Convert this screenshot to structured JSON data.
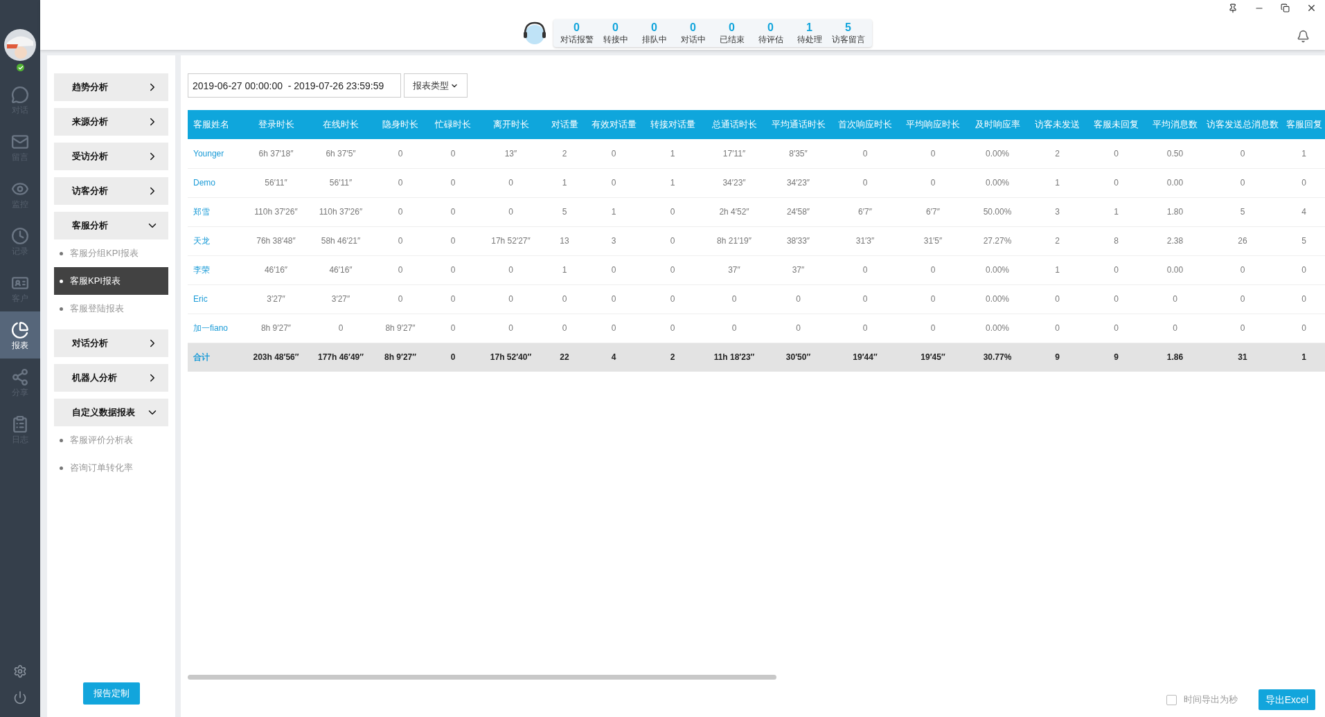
{
  "nav": [
    {
      "label": "对话",
      "selected": false
    },
    {
      "label": "留言",
      "selected": false
    },
    {
      "label": "监控",
      "selected": false
    },
    {
      "label": "记录",
      "selected": false
    },
    {
      "label": "客户",
      "selected": false
    },
    {
      "label": "报表",
      "selected": true
    },
    {
      "label": "分享",
      "selected": false
    },
    {
      "label": "日志",
      "selected": false
    }
  ],
  "stats": [
    {
      "value": "0",
      "label": "对话报警"
    },
    {
      "value": "0",
      "label": "转接中"
    },
    {
      "value": "0",
      "label": "排队中"
    },
    {
      "value": "0",
      "label": "对话中"
    },
    {
      "value": "0",
      "label": "已结束"
    },
    {
      "value": "0",
      "label": "待评估"
    },
    {
      "value": "1",
      "label": "待处理"
    },
    {
      "value": "5",
      "label": "访客留言"
    }
  ],
  "menu": [
    {
      "label": "趋势分析",
      "expanded": false
    },
    {
      "label": "来源分析",
      "expanded": false
    },
    {
      "label": "受访分析",
      "expanded": false
    },
    {
      "label": "访客分析",
      "expanded": false
    },
    {
      "label": "客服分析",
      "expanded": true,
      "children": [
        {
          "label": "客服分组KPI报表",
          "selected": false
        },
        {
          "label": "客服KPI报表",
          "selected": true
        },
        {
          "label": "客服登陆报表",
          "selected": false
        }
      ]
    },
    {
      "label": "对话分析",
      "expanded": false
    },
    {
      "label": "机器人分析",
      "expanded": false
    },
    {
      "label": "自定义数据报表",
      "expanded": true,
      "children": [
        {
          "label": "客服评价分析表",
          "selected": false
        },
        {
          "label": "咨询订单转化率",
          "selected": false
        }
      ]
    }
  ],
  "customize_button": "报告定制",
  "date_range": "2019-06-27 00:00:00  - 2019-07-26 23:59:59",
  "report_type_button": "报表类型",
  "table": {
    "columns": [
      "客服姓名",
      "登录时长",
      "在线时长",
      "隐身时长",
      "忙碌时长",
      "离开时长",
      "对话量",
      "有效对话量",
      "转接对话量",
      "总通话时长",
      "平均通话时长",
      "首次响应时长",
      "平均响应时长",
      "及时响应率",
      "访客未发送",
      "客服未回复",
      "平均消息数",
      "访客发送总消息数",
      "客服回复"
    ],
    "rows": [
      {
        "cells": [
          "Younger",
          "6h 37′18″",
          "6h 37′5″",
          "0",
          "0",
          "13″",
          "2",
          "0",
          "1",
          "17′11″",
          "8′35″",
          "0",
          "0",
          "0.00%",
          "2",
          "0",
          "0.50",
          "0",
          "1"
        ]
      },
      {
        "cells": [
          "Demo",
          "56′11″",
          "56′11″",
          "0",
          "0",
          "0",
          "1",
          "0",
          "1",
          "34′23″",
          "34′23″",
          "0",
          "0",
          "0.00%",
          "1",
          "0",
          "0.00",
          "0",
          "0"
        ]
      },
      {
        "cells": [
          "郑雪",
          "110h 37′26″",
          "110h 37′26″",
          "0",
          "0",
          "0",
          "5",
          "1",
          "0",
          "2h 4′52″",
          "24′58″",
          "6′7″",
          "6′7″",
          "50.00%",
          "3",
          "1",
          "1.80",
          "5",
          "4"
        ]
      },
      {
        "cells": [
          "天龙",
          "76h 38′48″",
          "58h 46′21″",
          "0",
          "0",
          "17h 52′27″",
          "13",
          "3",
          "0",
          "8h 21′19″",
          "38′33″",
          "31′3″",
          "31′5″",
          "27.27%",
          "2",
          "8",
          "2.38",
          "26",
          "5"
        ]
      },
      {
        "cells": [
          "李荣",
          "46′16″",
          "46′16″",
          "0",
          "0",
          "0",
          "1",
          "0",
          "0",
          "37″",
          "37″",
          "0",
          "0",
          "0.00%",
          "1",
          "0",
          "0.00",
          "0",
          "0"
        ]
      },
      {
        "cells": [
          "Eric",
          "3′27″",
          "3′27″",
          "0",
          "0",
          "0",
          "0",
          "0",
          "0",
          "0",
          "0",
          "0",
          "0",
          "0.00%",
          "0",
          "0",
          "0",
          "0",
          "0"
        ]
      },
      {
        "cells": [
          "加一fiano",
          "8h 9′27″",
          "0",
          "8h 9′27″",
          "0",
          "0",
          "0",
          "0",
          "0",
          "0",
          "0",
          "0",
          "0",
          "0.00%",
          "0",
          "0",
          "0",
          "0",
          "0"
        ]
      }
    ],
    "total": [
      "合计",
      "203h 48′56″",
      "177h 46′49″",
      "8h 9′27″",
      "0",
      "17h 52′40″",
      "22",
      "4",
      "2",
      "11h 18′23″",
      "30′50″",
      "19′44″",
      "19′45″",
      "30.77%",
      "9",
      "9",
      "1.86",
      "31",
      "1"
    ]
  },
  "export_seconds": {
    "label": "时间导出为秒",
    "checked": false
  },
  "export_button": "导出Excel"
}
